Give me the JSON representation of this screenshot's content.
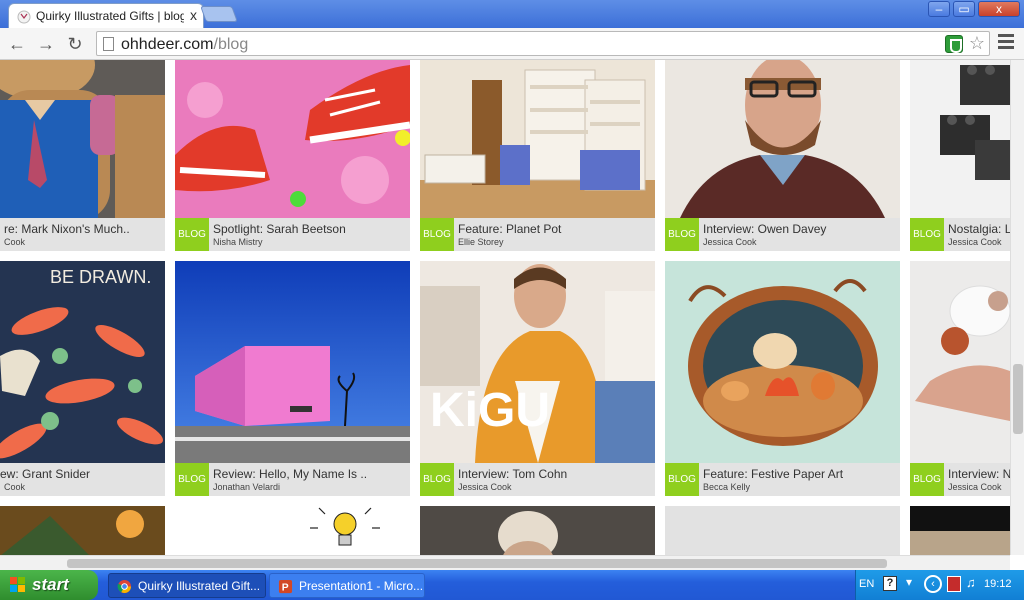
{
  "browser": {
    "tab_title": "Quirky Illustrated Gifts | blog",
    "tab_close": "x",
    "url_host": "ohhdeer.com",
    "url_path": "/blog",
    "win_min": "–",
    "win_max": "▭",
    "win_close": "x"
  },
  "posts": {
    "badge": "BLOG",
    "row1": [
      {
        "title": "re: Mark Nixon's Much..",
        "author": "Cook"
      },
      {
        "title": "Spotlight: Sarah Beetson",
        "author": "Nisha Mistry"
      },
      {
        "title": "Feature: Planet Pot",
        "author": "Ellie Storey"
      },
      {
        "title": "Interview: Owen Davey",
        "author": "Jessica Cook"
      },
      {
        "title": "Nostalgia: L",
        "author": "Jessica Cook"
      }
    ],
    "row2": [
      {
        "title": "ew: Grant Snider",
        "author": "Cook"
      },
      {
        "title": "Review: Hello, My Name Is ..",
        "author": "Jonathan Velardi"
      },
      {
        "title": "Interview: Tom Cohn",
        "author": "Jessica Cook"
      },
      {
        "title": "Feature: Festive Paper Art",
        "author": "Becca Kelly"
      },
      {
        "title": "Interview: N",
        "author": "Jessica Cook"
      }
    ],
    "image_text": {
      "be_drawn": "BE DRAWN.",
      "kigu": "KiGU"
    }
  },
  "taskbar": {
    "start_label": "start",
    "tasks": [
      {
        "label": "Quirky Illustrated Gift..."
      },
      {
        "label": "Presentation1 - Micro..."
      }
    ],
    "lang": "EN",
    "help": "?",
    "clock": "19:12"
  },
  "colors": {
    "badge_green": "#8fcf1e",
    "meta_gray": "#e3e3e3",
    "taskbar_blue": "#245edb",
    "start_green": "#3c9a3b"
  }
}
